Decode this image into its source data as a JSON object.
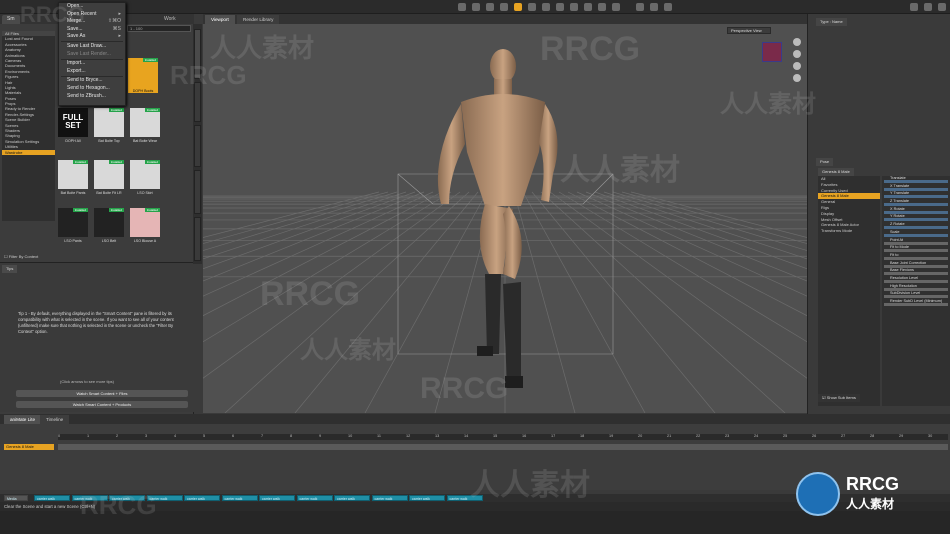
{
  "file_menu": {
    "items": [
      {
        "label": "Open...",
        "shortcut": "",
        "disabled": false
      },
      {
        "label": "Open Recent",
        "shortcut": "▸",
        "disabled": false
      },
      {
        "label": "Merge...",
        "shortcut": "⇧⌘O",
        "disabled": false
      },
      {
        "label": "Save...",
        "shortcut": "⌘S",
        "disabled": false
      },
      {
        "label": "Save As",
        "shortcut": "▸",
        "disabled": false
      },
      {
        "label": "Save Last Draw...",
        "shortcut": "",
        "disabled": false
      },
      {
        "label": "Save Last Render...",
        "shortcut": "",
        "disabled": true
      },
      {
        "label": "Import...",
        "shortcut": "",
        "disabled": false
      },
      {
        "label": "Export...",
        "shortcut": "",
        "disabled": false
      },
      {
        "label": "Send to Bryce...",
        "shortcut": "",
        "disabled": false
      },
      {
        "label": "Send to Hexagon...",
        "shortcut": "",
        "disabled": false
      },
      {
        "label": "Send to ZBrush...",
        "shortcut": "",
        "disabled": false
      }
    ]
  },
  "left_panel": {
    "tab_label": "Sm",
    "offline_tab": "Work Offline",
    "search_placeholder": "1 - 100",
    "categories": [
      "All Files",
      "Lost and Found",
      "Accessories",
      "Anatomy",
      "Animations",
      "Cameras",
      "Documents",
      "Environments",
      "Figures",
      "Hair",
      "Lights",
      "Materials",
      "Poses",
      "Props",
      "Ready to Render",
      "Render-Settings",
      "Scene Builder",
      "Scenes",
      "Shaders",
      "Shaping",
      "Simulation Settings",
      "Utilities",
      "Wardrobe"
    ],
    "selected_category": "Wardrobe",
    "filter_label": "Filter By Context",
    "thumbnails": [
      {
        "label": "DOPH Boots",
        "badge": "Installed",
        "highlight": true,
        "style": "hl"
      },
      {
        "label": "DOPH All",
        "badge": "",
        "highlight": false,
        "style": "fullset",
        "text": "FULL SET"
      },
      {
        "label": "Bat Boite Top",
        "badge": "Installed",
        "highlight": false,
        "style": "light"
      },
      {
        "label": "Bat Boite Wear",
        "badge": "Installed",
        "highlight": false,
        "style": "light"
      },
      {
        "label": "Bat Boite Pants",
        "badge": "Installed",
        "highlight": false,
        "style": "light"
      },
      {
        "label": "Bat Boite Fit LR",
        "badge": "Installed",
        "highlight": false,
        "style": "light"
      },
      {
        "label": "LSO Skirt",
        "badge": "Installed",
        "highlight": false,
        "style": "light"
      },
      {
        "label": "LSO Pants",
        "badge": "Installed",
        "highlight": false,
        "style": "dark"
      },
      {
        "label": "LSO Belt",
        "badge": "Installed",
        "highlight": false,
        "style": "dark"
      },
      {
        "label": "LSO Blouse A",
        "badge": "Installed",
        "highlight": false,
        "style": "pink"
      }
    ]
  },
  "info_panel": {
    "tab": "Tips",
    "text": "Tip 1 - By default, everything displayed in the \"Smart Content\" pane is filtered by its compatibility with what is selected in the scene. If you want to see all of your content (unfiltered) make sure that nothing is selected in the scene or uncheck the \"Filter By Context\" option.",
    "hint": "(Click arrows to see more tips)",
    "btn1": "Watch Smart Content + Files",
    "btn2": "Watch Smart Content + Products"
  },
  "viewport": {
    "tabs": [
      "Viewport",
      "Render Library"
    ],
    "active_tab": "Viewport",
    "camera": "Perspective View"
  },
  "right_panel": {
    "title": "Type : Name",
    "subtab": "Pose",
    "scene_tab": "Genesis 8 Male",
    "scene_items": [
      "All",
      "Favorites",
      "Currently Used",
      "Genesis 8 Male",
      "General",
      "Rigs",
      "Display",
      "Mesh Offset",
      "Genesis 8 Male Actor",
      "Transforms Mode"
    ],
    "scene_selected": "Genesis 8 Male",
    "show_sub_items": "Show Sub Items",
    "params": [
      "Translate",
      "X Translate",
      "Y Translate",
      "Z Translate",
      "X Rotate",
      "Y Rotate",
      "Z Rotate",
      "Scale",
      "Point At",
      "Fit to Mode",
      "Fit to",
      "Base Joint Correction",
      "Base Flexions",
      "Resolution Level",
      "High Resolution",
      "SubDivision Level",
      "Render SubD Level (Minimum)"
    ]
  },
  "bottom": {
    "tabs": [
      "aniMate Lite",
      "Timeline"
    ],
    "track_label": "Genesis 8 Male",
    "frames": [
      "0",
      "1",
      "2",
      "3",
      "4",
      "5",
      "6",
      "7",
      "8",
      "9",
      "10",
      "11",
      "12",
      "13",
      "14",
      "15",
      "16",
      "17",
      "18",
      "19",
      "20",
      "21",
      "22",
      "23",
      "24",
      "25",
      "26",
      "27",
      "28",
      "29",
      "30"
    ],
    "keyframe_tag": "Media",
    "keys": [
      "carrier walk",
      "carrier walk",
      "carrier walk",
      "carrier walk",
      "carrier walk",
      "carrier walk",
      "carrier walk",
      "carrier walk",
      "carrier walk",
      "carrier walk",
      "carrier walk",
      "carrier walk"
    ],
    "status": "Clear the Scene and start a new Scene (Ctrl+N)"
  },
  "watermarks": [
    "RRCG",
    "人人素材",
    "RRCG",
    "人人素材",
    "RRCG",
    "人人素材",
    "RRCG",
    "人人素材",
    "RRCG",
    "人人素材",
    "RRCG"
  ],
  "logo": {
    "title": "RRCG",
    "subtitle": "人人素材"
  },
  "colors": {
    "accent": "#e7a322",
    "installed_badge": "#25a34a",
    "key_blue": "#1f8fa6"
  }
}
